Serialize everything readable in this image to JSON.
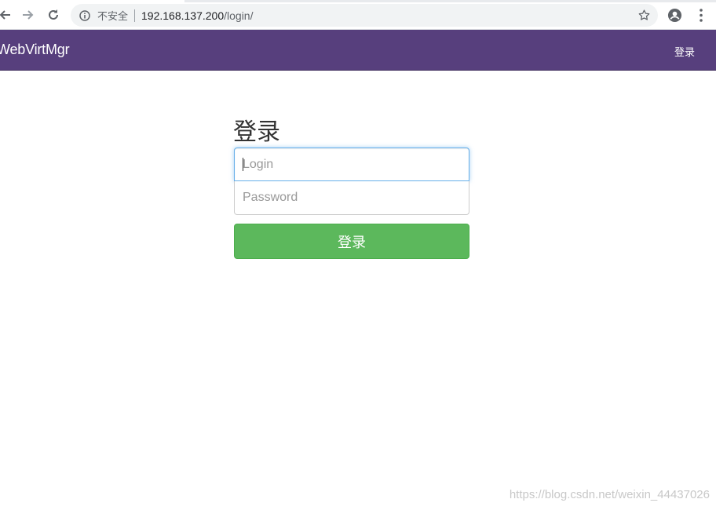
{
  "browser": {
    "security_label": "不安全",
    "url_host": "192.168.137.200",
    "url_path": "/login/",
    "icons": {
      "back": "back-arrow-icon",
      "forward": "forward-arrow-icon",
      "reload": "reload-icon",
      "info": "info-icon",
      "bookmark": "star-icon",
      "profile": "profile-icon",
      "menu": "kebab-menu-icon"
    }
  },
  "navbar": {
    "brand": "WebVirtMgr",
    "login_link": "登录",
    "bg_color": "#573f7d"
  },
  "form": {
    "title": "登录",
    "login_placeholder": "Login",
    "login_value": "",
    "password_placeholder": "Password",
    "password_value": "",
    "submit_label": "登录",
    "submit_color": "#5cb85c"
  },
  "watermark": "https://blog.csdn.net/weixin_44437026"
}
